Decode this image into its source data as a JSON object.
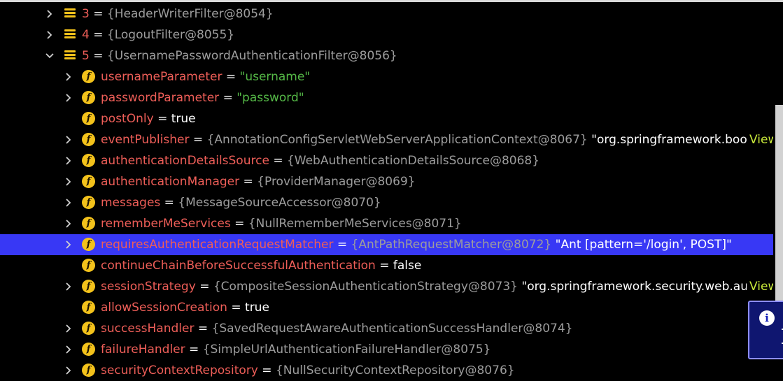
{
  "nodes": [
    {
      "level": 0,
      "expandable": true,
      "expanded": false,
      "icon": "list",
      "name": "3",
      "ref": "{HeaderWriterFilter@8054}"
    },
    {
      "level": 0,
      "expandable": true,
      "expanded": false,
      "icon": "list",
      "name": "4",
      "ref": "{LogoutFilter@8055}"
    },
    {
      "level": 0,
      "expandable": true,
      "expanded": true,
      "icon": "list",
      "name": "5",
      "ref": "{UsernamePasswordAuthenticationFilter@8056}"
    },
    {
      "level": 1,
      "expandable": true,
      "expanded": false,
      "icon": "field",
      "name": "usernameParameter",
      "str": "\"username\""
    },
    {
      "level": 1,
      "expandable": true,
      "expanded": false,
      "icon": "field",
      "name": "passwordParameter",
      "str": "\"password\""
    },
    {
      "level": 1,
      "expandable": false,
      "icon": "field",
      "name": "postOnly",
      "plain": "true"
    },
    {
      "level": 1,
      "expandable": true,
      "expanded": false,
      "icon": "field",
      "name": "eventPublisher",
      "ref": "{AnnotationConfigServletWebServerApplicationContext@8067}",
      "plain": "\"org.springframework.boot.web.ser...",
      "view": "View"
    },
    {
      "level": 1,
      "expandable": true,
      "expanded": false,
      "icon": "field",
      "name": "authenticationDetailsSource",
      "ref": "{WebAuthenticationDetailsSource@8068}"
    },
    {
      "level": 1,
      "expandable": true,
      "expanded": false,
      "icon": "field",
      "name": "authenticationManager",
      "ref": "{ProviderManager@8069}"
    },
    {
      "level": 1,
      "expandable": true,
      "expanded": false,
      "icon": "field",
      "name": "messages",
      "ref": "{MessageSourceAccessor@8070}"
    },
    {
      "level": 1,
      "expandable": true,
      "expanded": false,
      "icon": "field",
      "name": "rememberMeServices",
      "ref": "{NullRememberMeServices@8071}"
    },
    {
      "level": 1,
      "expandable": true,
      "expanded": false,
      "selected": true,
      "icon": "field",
      "name": "requiresAuthenticationRequestMatcher",
      "ref": "{AntPathRequestMatcher@8072}",
      "plain": "\"Ant [pattern='/login', POST]\""
    },
    {
      "level": 1,
      "expandable": false,
      "icon": "field",
      "name": "continueChainBeforeSuccessfulAuthentication",
      "plain": "false"
    },
    {
      "level": 1,
      "expandable": true,
      "expanded": false,
      "icon": "field",
      "name": "sessionStrategy",
      "ref": "{CompositeSessionAuthenticationStrategy@8073}",
      "plain": "\"org.springframework.security.web.authenticatic...",
      "view": "View"
    },
    {
      "level": 1,
      "expandable": false,
      "icon": "field",
      "name": "allowSessionCreation",
      "plain": "true"
    },
    {
      "level": 1,
      "expandable": true,
      "expanded": false,
      "icon": "field",
      "name": "successHandler",
      "ref": "{SavedRequestAwareAuthenticationSuccessHandler@8074}"
    },
    {
      "level": 1,
      "expandable": true,
      "expanded": false,
      "icon": "field",
      "name": "failureHandler",
      "ref": "{SimpleUrlAuthenticationFailureHandler@8075}"
    },
    {
      "level": 1,
      "expandable": true,
      "expanded": false,
      "icon": "field",
      "name": "securityContextRepository",
      "ref": "{NullSecurityContextRepository@8076}"
    }
  ],
  "equals": "=",
  "info_popup": {
    "icon": "info-icon",
    "glyph": "i"
  },
  "colors": {
    "background": "#000000",
    "selection": "#3838f5",
    "name": "#ee5e58",
    "reference": "#9d9d9d",
    "string": "#55b947",
    "icon": "#f3c21b",
    "link": "#c8e83a"
  }
}
